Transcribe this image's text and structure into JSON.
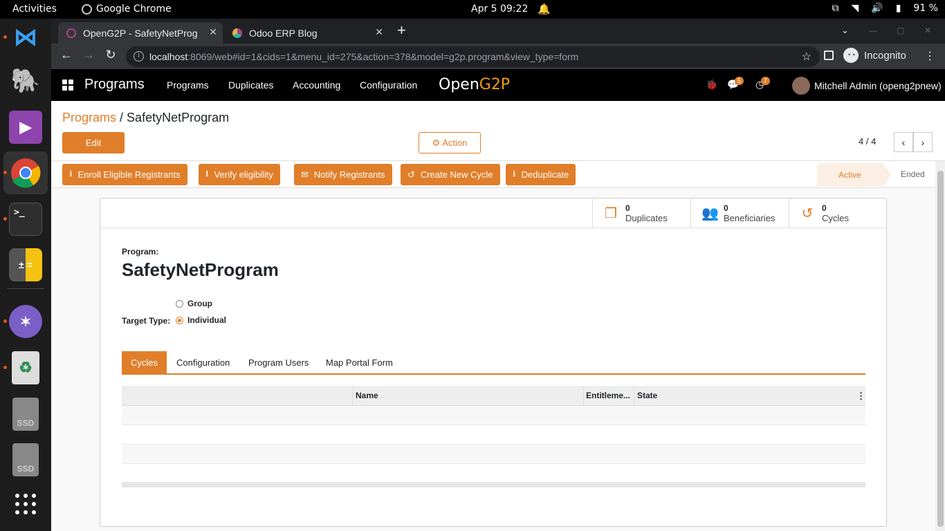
{
  "system": {
    "activities": "Activities",
    "app_name": "Google Chrome",
    "clock": "Apr 5  09:22",
    "battery": "91 %"
  },
  "browser": {
    "tabs": [
      {
        "title": "OpenG2P - SafetyNetProg",
        "active": true
      },
      {
        "title": "Odoo ERP Blog",
        "active": false
      }
    ],
    "url_host": "localhost",
    "url_path": ":8069/web#id=1&cids=1&menu_id=275&action=378&model=g2p.program&view_type=form",
    "incognito_label": "Incognito"
  },
  "odoo_nav": {
    "app_title": "Programs",
    "menus": [
      "Programs",
      "Duplicates",
      "Accounting",
      "Configuration"
    ],
    "logo_open": "Open",
    "logo_g2p": "G2P",
    "messages_count": "5",
    "activities_count": "7",
    "user": "Mitchell Admin (openg2pnew)"
  },
  "control_panel": {
    "breadcrumb_parent": "Programs",
    "breadcrumb_sep": " / ",
    "breadcrumb_current": "SafetyNetProgram",
    "edit_label": "Edit",
    "action_label": "⚙ Action",
    "pager": "4 / 4"
  },
  "statusbar": {
    "buttons": [
      "Enroll Eligible Registrants",
      "Verify eligibility",
      "Notify Registrants",
      "Create New Cycle",
      "Deduplicate"
    ],
    "stages": [
      "Active",
      "Ended"
    ]
  },
  "form": {
    "stats": [
      {
        "value": "0",
        "label": "Duplicates"
      },
      {
        "value": "0",
        "label": "Beneficiaries"
      },
      {
        "value": "0",
        "label": "Cycles"
      }
    ],
    "program_label": "Program:",
    "program_name": "SafetyNetProgram",
    "target_type_label": "Target Type:",
    "target_options": [
      "Group",
      "Individual"
    ],
    "target_selected": "Individual",
    "tabs": [
      "Cycles",
      "Configuration",
      "Program Users",
      "Map Portal Form"
    ],
    "grid_columns": [
      "Name",
      "Entitleme...",
      "State"
    ]
  }
}
